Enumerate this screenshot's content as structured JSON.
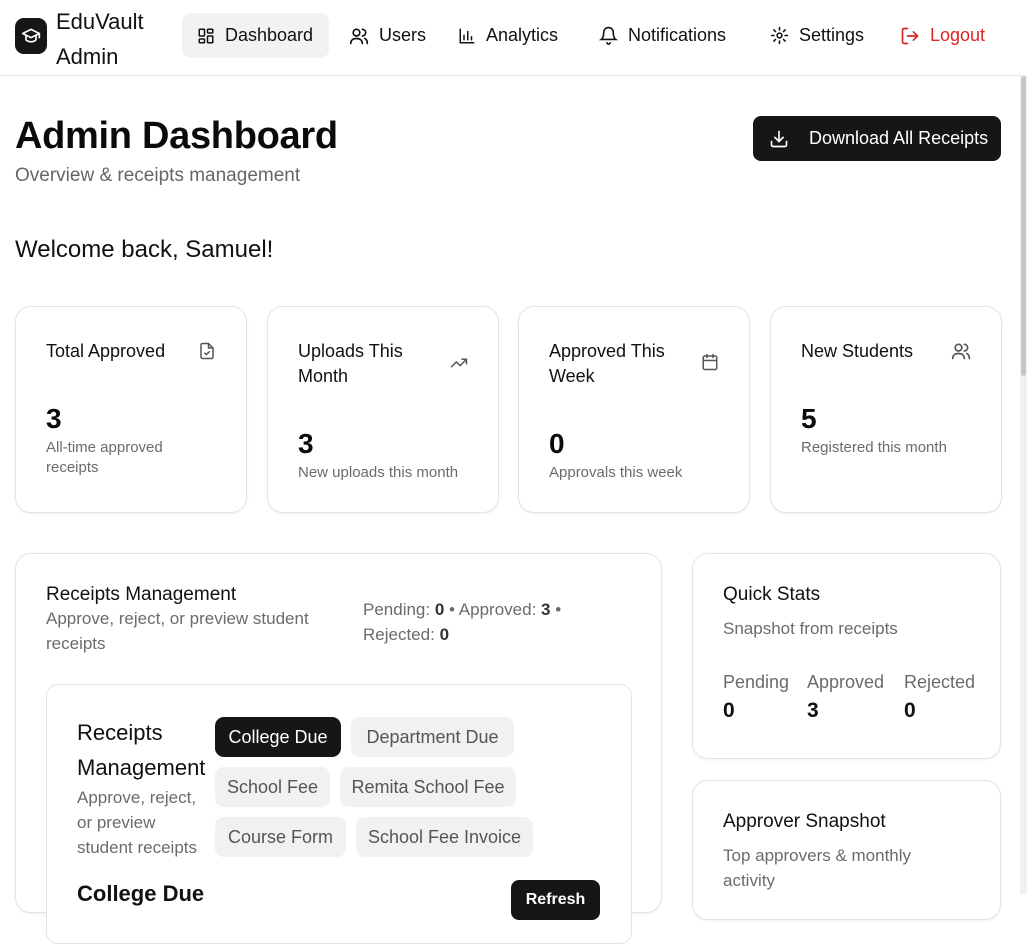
{
  "brand": {
    "name": "EduVault Admin"
  },
  "nav": {
    "dashboard": "Dashboard",
    "users": "Users",
    "analytics": "Analytics",
    "notifications": "Notifications",
    "settings": "Settings",
    "logout": "Logout"
  },
  "header": {
    "title": "Admin Dashboard",
    "subtitle": "Overview & receipts management",
    "download_label": "Download All Receipts"
  },
  "welcome": "Welcome back, Samuel!",
  "stats": [
    {
      "title": "Total Approved",
      "value": "3",
      "desc": "All-time approved receipts",
      "icon": "file-check-icon"
    },
    {
      "title": "Uploads This Month",
      "value": "3",
      "desc": "New uploads this month",
      "icon": "trending-up-icon"
    },
    {
      "title": "Approved This Week",
      "value": "0",
      "desc": "Approvals this week",
      "icon": "calendar-icon"
    },
    {
      "title": "New Students",
      "value": "5",
      "desc": "Registered this month",
      "icon": "users-icon"
    }
  ],
  "receipts": {
    "title": "Receipts Management",
    "subtitle": "Approve, reject, or preview student receipts",
    "counts": {
      "pending_label": "Pending:",
      "pending": "0",
      "approved_label": "Approved:",
      "approved": "3",
      "rejected_label": "Rejected:",
      "rejected": "0"
    },
    "inner": {
      "title": "Receipts Management",
      "subtitle": "Approve, reject, or preview student receipts",
      "categories": [
        "College Due",
        "Department Due",
        "School Fee",
        "Remita School Fee",
        "Course Form",
        "School Fee Invoice"
      ],
      "active_category": "College Due",
      "section_heading": "College Due",
      "refresh_label": "Refresh"
    }
  },
  "quick_stats": {
    "title": "Quick Stats",
    "subtitle": "Snapshot from receipts",
    "items": [
      {
        "label": "Pending",
        "value": "0"
      },
      {
        "label": "Approved",
        "value": "3"
      },
      {
        "label": "Rejected",
        "value": "0"
      }
    ]
  },
  "approver_snapshot": {
    "title": "Approver Snapshot",
    "subtitle": "Top approvers & monthly activity"
  }
}
